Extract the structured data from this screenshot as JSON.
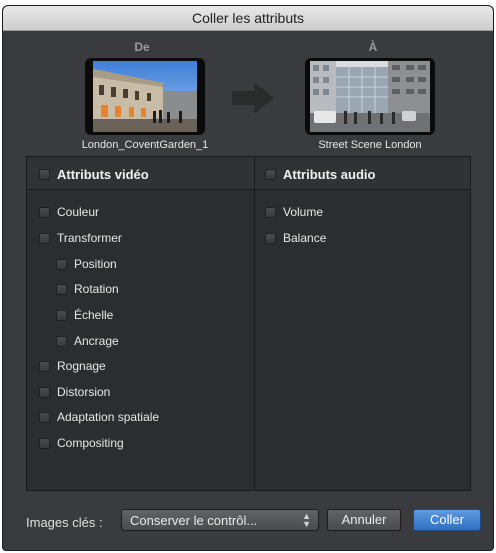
{
  "window": {
    "title": "Coller les attributs"
  },
  "source": {
    "label": "De",
    "clip_name": "London_CoventGarden_1"
  },
  "destination": {
    "label": "À",
    "clip_name": "Street Scene London"
  },
  "video": {
    "header": "Attributs vidéo",
    "items": [
      {
        "label": "Couleur",
        "indent": false,
        "checked": false
      },
      {
        "label": "Transformer",
        "indent": false,
        "checked": false
      },
      {
        "label": "Position",
        "indent": true,
        "checked": false
      },
      {
        "label": "Rotation",
        "indent": true,
        "checked": false
      },
      {
        "label": "Échelle",
        "indent": true,
        "checked": false
      },
      {
        "label": "Ancrage",
        "indent": true,
        "checked": false
      },
      {
        "label": "Rognage",
        "indent": false,
        "checked": false
      },
      {
        "label": "Distorsion",
        "indent": false,
        "checked": false
      },
      {
        "label": "Adaptation spatiale",
        "indent": false,
        "checked": false
      },
      {
        "label": "Compositing",
        "indent": false,
        "checked": false
      }
    ]
  },
  "audio": {
    "header": "Attributs audio",
    "items": [
      {
        "label": "Volume",
        "checked": false
      },
      {
        "label": "Balance",
        "checked": false
      }
    ]
  },
  "footer": {
    "keyframes_label": "Images clés :",
    "keyframes_value": "Conserver le contrôl...",
    "cancel_label": "Annuler",
    "paste_label": "Coller"
  },
  "colors": {
    "accent": "#3d7fd0",
    "panel": "#2c2d30",
    "window": "#3a3b3e"
  }
}
